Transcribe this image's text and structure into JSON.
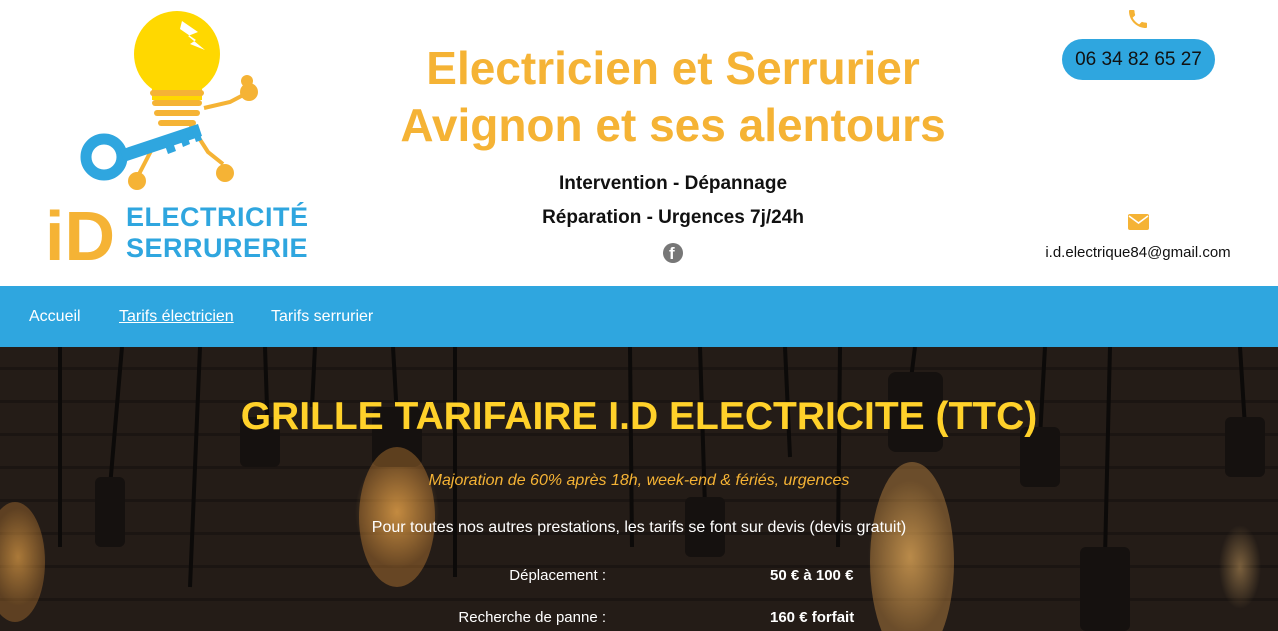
{
  "header": {
    "logo": {
      "letters": "iD",
      "line1": "ELECTRICITÉ",
      "line2": "SERRURERIE"
    },
    "title_line1": "Electricien et Serrurier",
    "title_line2": "Avignon et ses alentours",
    "subtitle1": "Intervention - Dépannage",
    "subtitle2": "Réparation - Urgences 7j/24h",
    "social_icon": "facebook-icon",
    "phone": "06 34 82 65 27",
    "email": "i.d.electrique84@gmail.com"
  },
  "nav": {
    "items": [
      {
        "label": "Accueil",
        "active": false
      },
      {
        "label": "Tarifs électricien",
        "active": true
      },
      {
        "label": "Tarifs serrurier",
        "active": false
      }
    ]
  },
  "hero": {
    "title": "GRILLE TARIFAIRE I.D ELECTRICITE (TTC)",
    "note": "Majoration de 60% après 18h, week-end & fériés, urgences",
    "info": "Pour toutes nos autres prestations, les tarifs se font sur devis (devis gratuit)",
    "prices": [
      {
        "label": "Déplacement :",
        "value": "50 € à 100 €"
      },
      {
        "label": "Recherche de panne :",
        "value": "160 € forfait"
      }
    ]
  },
  "colors": {
    "accent_blue": "#2fa6df",
    "accent_orange": "#f5b335",
    "hero_yellow": "#ffd12a"
  }
}
